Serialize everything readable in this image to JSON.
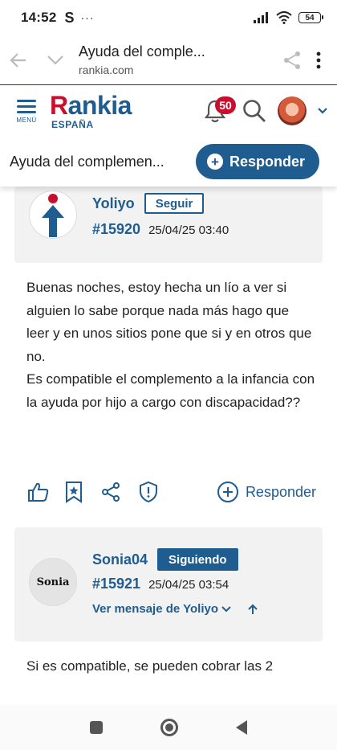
{
  "status_bar": {
    "time": "14:52",
    "carrier_icon": "S",
    "more": "···",
    "battery": "54"
  },
  "browser": {
    "page_title": "Ayuda del comple...",
    "host": "rankia.com"
  },
  "site_header": {
    "menu_label": "MENÚ",
    "logo_text_red": "R",
    "logo_text_blue": "ankia",
    "logo_sub": "ESPAÑA",
    "notification_count": "50"
  },
  "thread_bar": {
    "title": "Ayuda del complemen...",
    "reply_label": "Responder"
  },
  "posts": [
    {
      "author": "Yoliyo",
      "follow_label": "Seguir",
      "number": "#15920",
      "date": "25/04/25 03:40",
      "body": "Buenas noches, estoy hecha un lío a ver si alguien lo sabe porque nada más hago que leer y en unos sitios pone que si y en otros que no.\nEs compatible el complemento a la infancia con la ayuda por hijo a cargo con discapacidad??",
      "reply_label": "Responder"
    },
    {
      "author": "Sonia04",
      "follow_label": "Siguiendo",
      "number": "#15921",
      "date": "25/04/25 03:54",
      "reply_to": "Ver mensaje de Yoliyo",
      "avatar_text": "Sonia",
      "body": "Si es compatible, se pueden cobrar las 2"
    }
  ],
  "colors": {
    "brand_blue": "#1f5c8f",
    "brand_red": "#c8102e"
  }
}
